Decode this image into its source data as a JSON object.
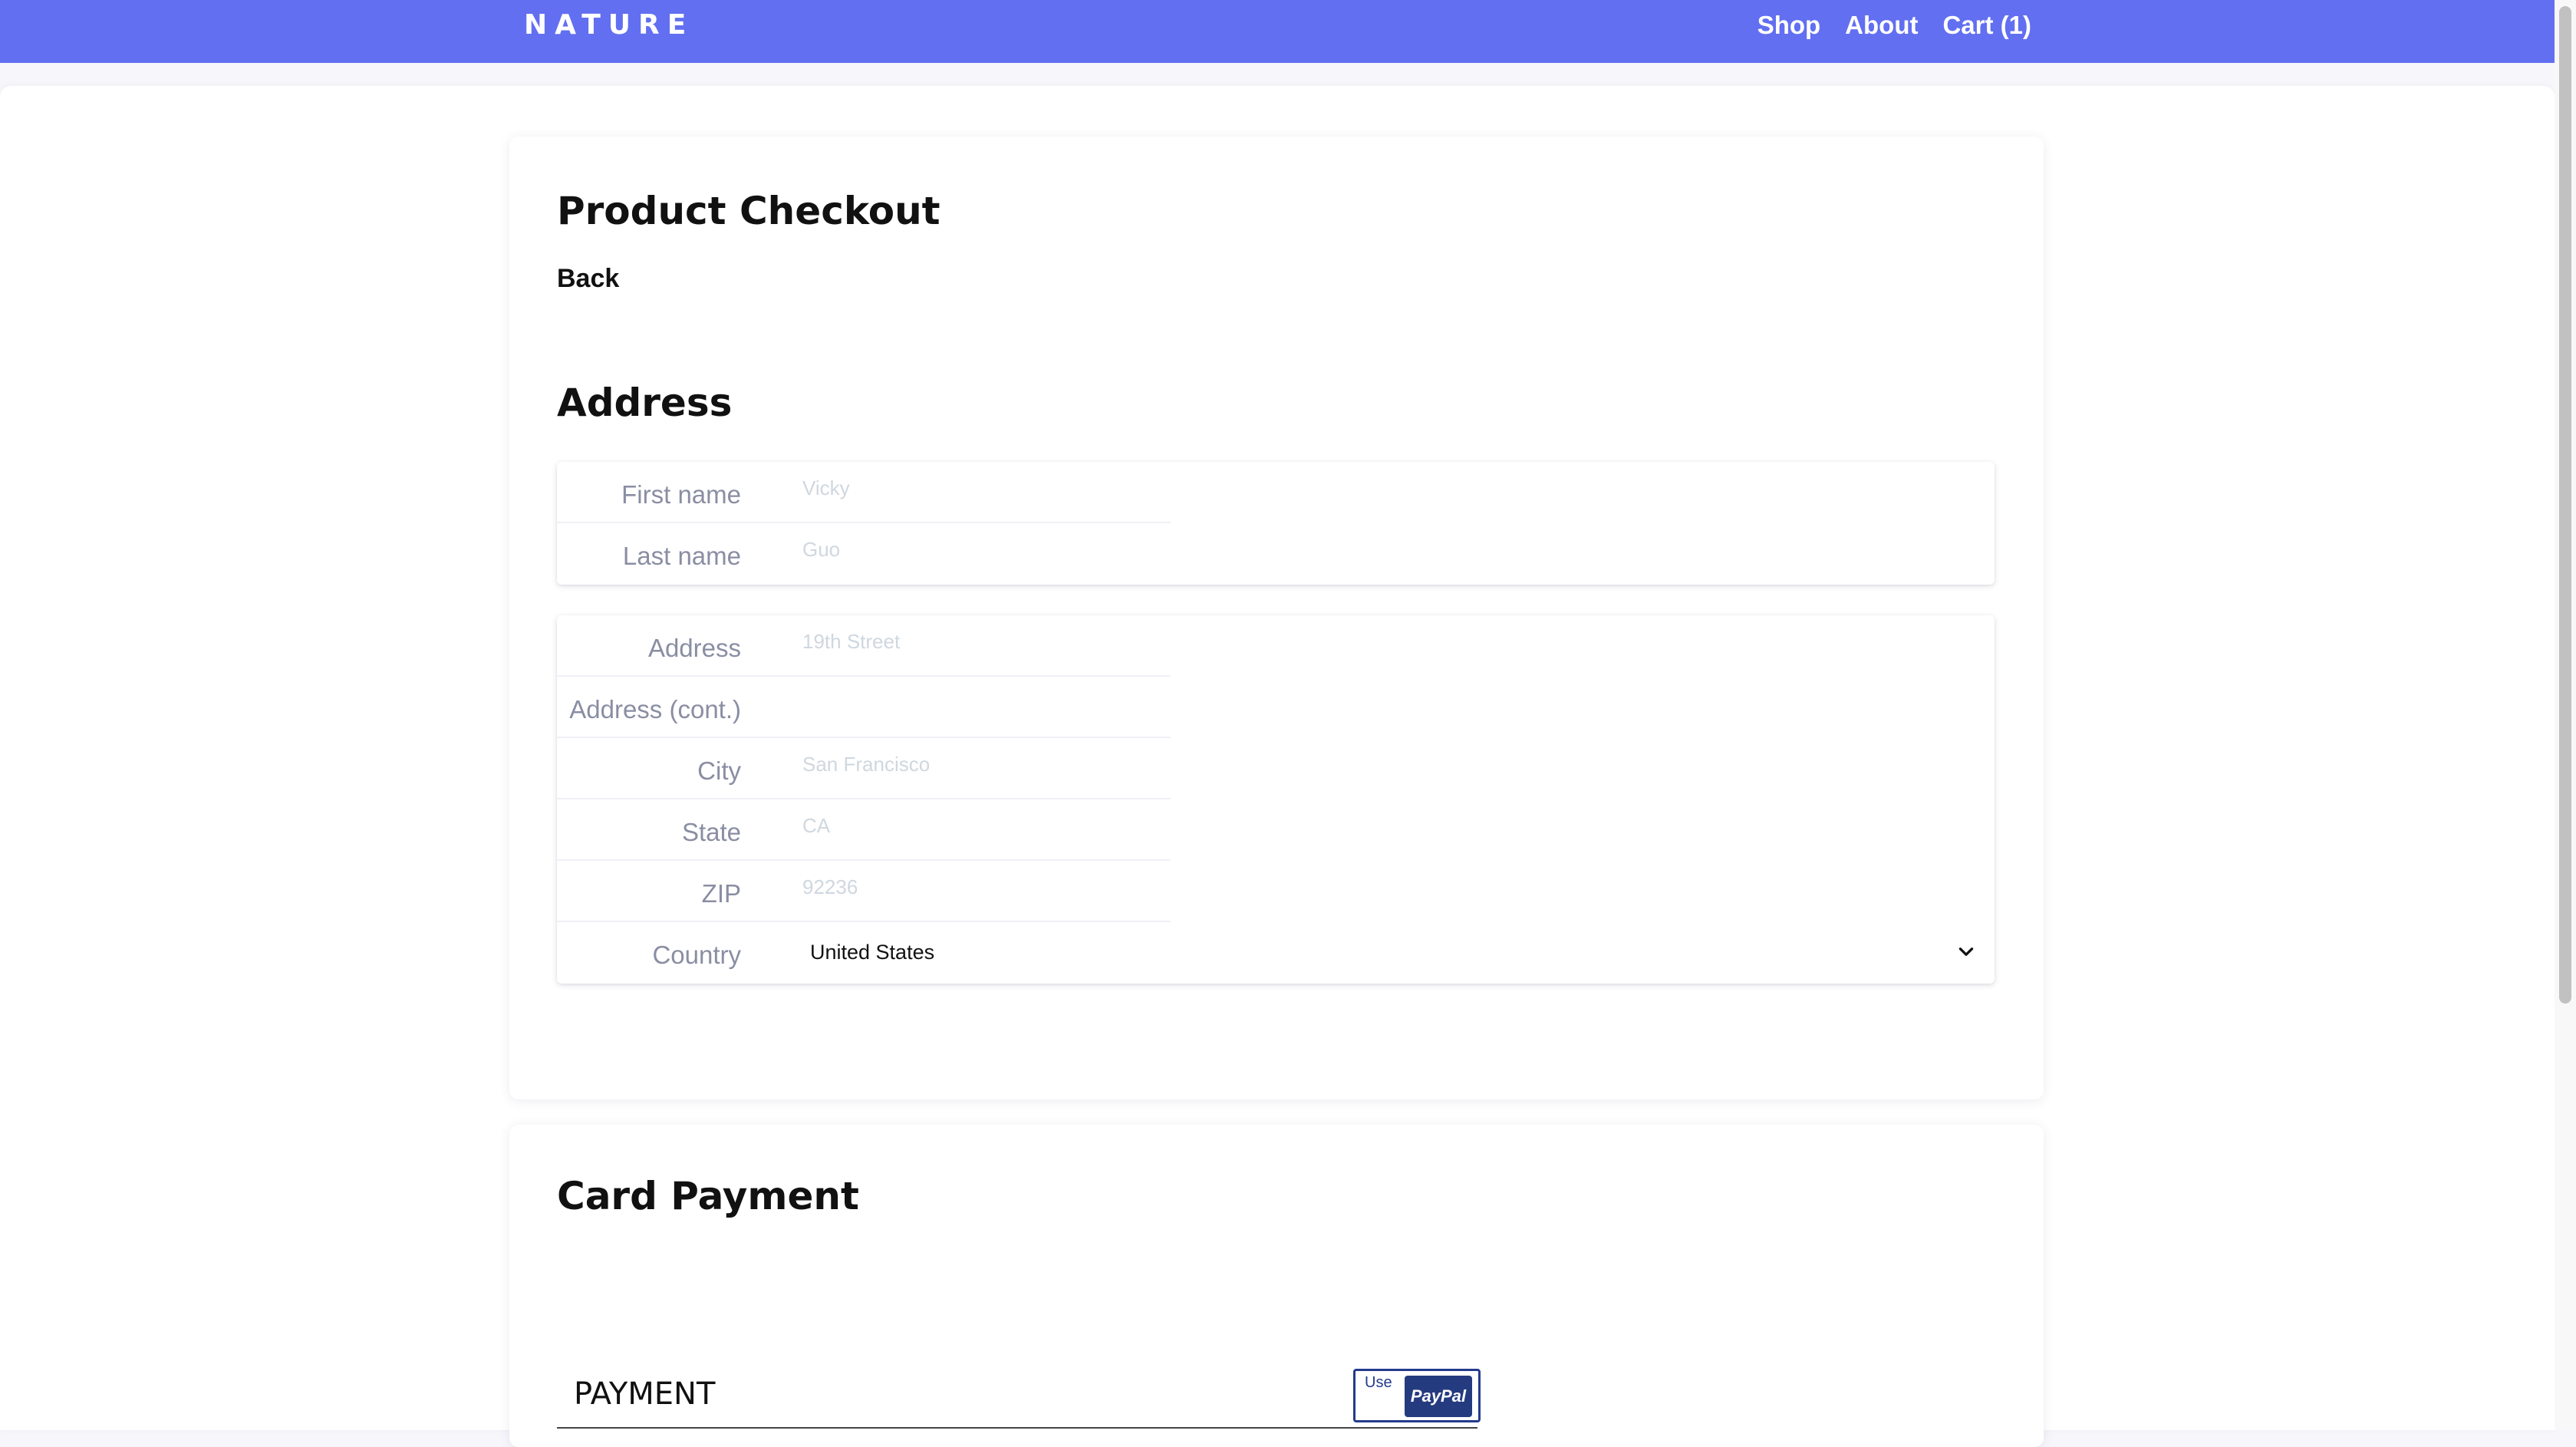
{
  "navbar": {
    "brand": "NATURE",
    "links": [
      "Shop",
      "About",
      "Cart (1)"
    ],
    "background_color": "#626ff1"
  },
  "checkout": {
    "title": "Product Checkout",
    "back_label": "Back",
    "address_title": "Address",
    "name_fields": [
      {
        "label": "First name",
        "placeholder": "Vicky",
        "value": ""
      },
      {
        "label": "Last name",
        "placeholder": "Guo",
        "value": ""
      }
    ],
    "address_fields": [
      {
        "label": "Address",
        "placeholder": "19th Street",
        "value": ""
      },
      {
        "label": "Address (cont.)",
        "placeholder": "",
        "value": ""
      },
      {
        "label": "City",
        "placeholder": "San Francisco",
        "value": ""
      },
      {
        "label": "State",
        "placeholder": "CA",
        "value": ""
      },
      {
        "label": "ZIP",
        "placeholder": "92236",
        "value": ""
      }
    ],
    "country": {
      "label": "Country",
      "selected": "United States"
    }
  },
  "payment": {
    "title": "Card Payment",
    "section_label": "PAYMENT",
    "paypal": {
      "use_label": "Use",
      "brand_label": "PayPal",
      "color": "#253b80"
    }
  }
}
